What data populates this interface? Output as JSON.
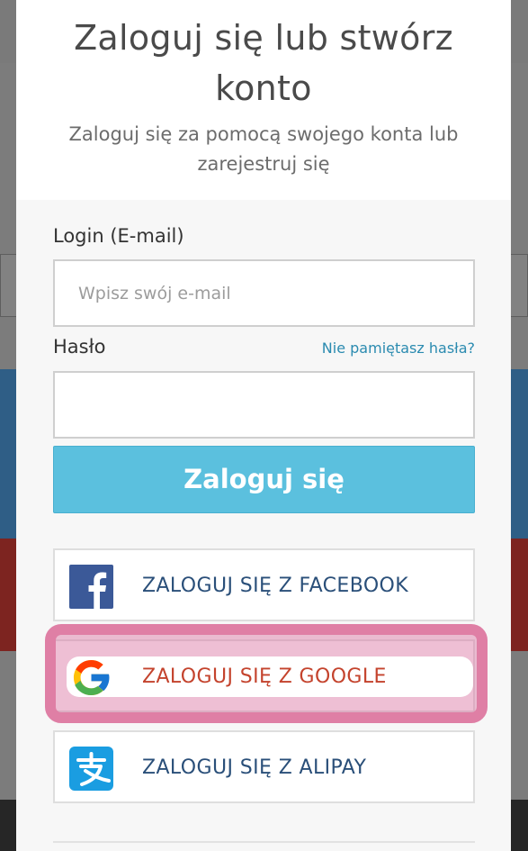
{
  "modal": {
    "title": "Zaloguj się lub stwórz konto",
    "subtitle": "Zaloguj się za pomocą swojego konta lub zarejestruj się"
  },
  "form": {
    "login_label": "Login (E-mail)",
    "email_placeholder": "Wpisz swój e-mail",
    "email_value": "",
    "password_label": "Hasło",
    "password_value": "",
    "forgot_link": "Nie pamiętasz hasła?",
    "submit_label": "Zaloguj się"
  },
  "social": {
    "facebook": {
      "label": "ZALOGUJ SIĘ Z FACEBOOK",
      "icon": "facebook-icon",
      "color": "#3b5998"
    },
    "google": {
      "label": "ZALOGUJ SIĘ Z GOOGLE",
      "icon": "google-icon",
      "color": "#c4432d"
    },
    "alipay": {
      "label": "ZALOGUJ SIĘ Z ALIPAY",
      "icon": "alipay-icon",
      "color": "#1a9de1"
    }
  },
  "colors": {
    "accent": "#5bc0de",
    "link": "#2b8bb0",
    "social_text": "#2a4f79",
    "highlight": "#df7fa5"
  }
}
